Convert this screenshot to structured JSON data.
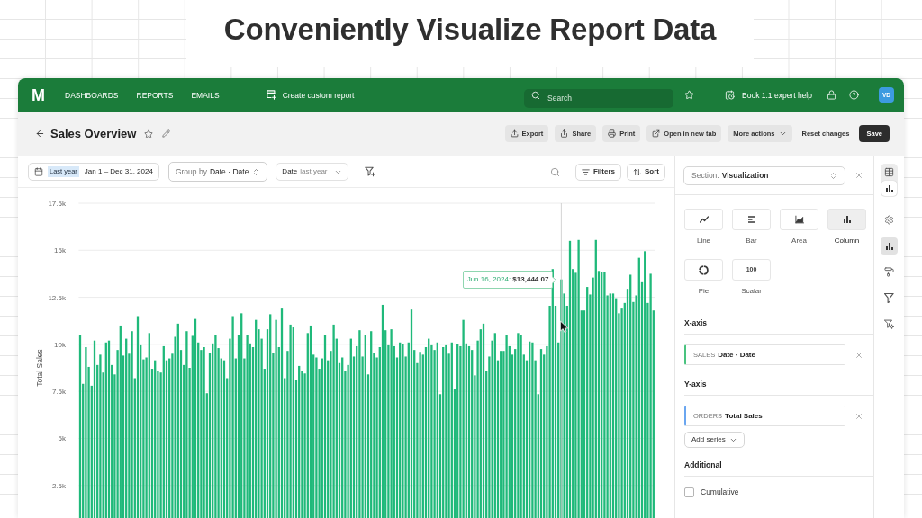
{
  "headline": "Conveniently Visualize Report Data",
  "nav": {
    "logo": "M",
    "links": [
      "DASHBOARDS",
      "REPORTS",
      "EMAILS"
    ],
    "create_report": "Create custom report",
    "search": {
      "placeholder": "Search"
    },
    "help_link": "Book 1:1 expert help",
    "avatar": "VD"
  },
  "report": {
    "title": "Sales Overview",
    "actions": [
      {
        "label": "Export",
        "kind": "upload"
      },
      {
        "label": "Share",
        "kind": "share"
      },
      {
        "label": "Print",
        "kind": "print"
      },
      {
        "label": "Open in new tab",
        "kind": "external"
      },
      {
        "label": "More actions",
        "kind": "menu"
      }
    ],
    "reset": "Reset changes",
    "save": "Save"
  },
  "toolbar": {
    "date_range": {
      "preset": "Last year",
      "range": "Jan 1 – Dec 31, 2024"
    },
    "group_by": {
      "label": "Group by",
      "value": "Date · Date"
    },
    "date_filter": {
      "field": "Date",
      "value": "last year"
    },
    "filters": "Filters",
    "sort": "Sort"
  },
  "chart": {
    "chart_data": {
      "type": "bar",
      "ylabel": "Total Sales",
      "ylim": [
        0,
        17500
      ],
      "grid": true,
      "yticks": [
        {
          "value": 2500,
          "label": "2.5k"
        },
        {
          "value": 5000,
          "label": "5k"
        },
        {
          "value": 7500,
          "label": "7.5k"
        },
        {
          "value": 10000,
          "label": "10k"
        },
        {
          "value": 12500,
          "label": "12.5k"
        },
        {
          "value": 15000,
          "label": "15k"
        },
        {
          "value": 17500,
          "label": "17.5k"
        }
      ],
      "series": [
        {
          "color": "#1fb97a",
          "values": [
            10500,
            7900,
            9850,
            8800,
            7800,
            10200,
            8900,
            9450,
            8500,
            10100,
            10200,
            8900,
            8400,
            9700,
            11000,
            9400,
            10300,
            9500,
            10700,
            8200,
            11500,
            9950,
            9200,
            9300,
            10600,
            8700,
            9150,
            8600,
            8500,
            9900,
            9150,
            9250,
            9500,
            10400,
            11100,
            9700,
            8900,
            10700,
            8750,
            10450,
            11350,
            10100,
            9700,
            9850,
            7400,
            9550,
            10050,
            10500,
            9800,
            9250,
            9150,
            8200,
            10300,
            11500,
            9250,
            10500,
            11650,
            9250,
            10500,
            10050,
            9850,
            11300,
            10800,
            10300,
            8700,
            10800,
            11600,
            9550,
            11300,
            9850,
            11900,
            8200,
            9650,
            11050,
            10900,
            8100,
            8850,
            8600,
            8450,
            10600,
            11000,
            9450,
            9300,
            8700,
            9250,
            10500,
            9150,
            9650,
            11050,
            10300,
            9000,
            9300,
            8600,
            8900,
            10300,
            9350,
            9900,
            10750,
            9350,
            10500,
            8400,
            10700,
            9550,
            9300,
            9850,
            12100,
            10750,
            9950,
            10800,
            9900,
            9300,
            10100,
            10000,
            9350,
            10100,
            11850,
            9700,
            9000,
            9600,
            9450,
            9850,
            10300,
            9950,
            9700,
            10100,
            7350,
            9850,
            9950,
            9500,
            10100,
            7600,
            10000,
            9900,
            11300,
            10050,
            9900,
            9700,
            8350,
            10200,
            10800,
            11100,
            8600,
            9350,
            10200,
            10600,
            9150,
            9650,
            9650,
            10500,
            9900,
            9450,
            9750,
            10600,
            10500,
            9450,
            9150,
            10150,
            10100,
            9150,
            7350,
            9750,
            9450,
            9900,
            12050,
            14000,
            12050,
            10100,
            13450,
            12700,
            12050,
            15500,
            14000,
            13800,
            15550,
            11800,
            11800,
            13050,
            12650,
            13550,
            15550,
            13900,
            13850,
            13850,
            12600,
            12700,
            12700,
            12450,
            11650,
            11900,
            12200,
            12950,
            13700,
            12250,
            12600,
            14600,
            13300,
            14950,
            12200,
            13750,
            11800
          ]
        }
      ],
      "annotations": [
        "Jun 16, 2024: **$13,444.07**"
      ]
    }
  },
  "panel": {
    "section": {
      "label": "Section:",
      "value": "Visualization"
    },
    "chart_types": [
      {
        "label": "Line",
        "kind": "line",
        "selected": false
      },
      {
        "label": "Bar",
        "kind": "bar",
        "selected": false
      },
      {
        "label": "Area",
        "kind": "area",
        "selected": false
      },
      {
        "label": "Column",
        "kind": "column",
        "selected": true
      },
      {
        "label": "Pie",
        "kind": "pie",
        "selected": false
      },
      {
        "label": "Scalar",
        "kind": "scalar",
        "selected": false,
        "icon_text": "100"
      }
    ],
    "x_axis": {
      "title": "X-axis",
      "source": "SALES",
      "field": "Date · Date"
    },
    "y_axis": {
      "title": "Y-axis",
      "source": "ORDERS",
      "field": "Total Sales",
      "add": "Add series"
    },
    "additional": {
      "title": "Additional",
      "options": [
        {
          "label": "Cumulative",
          "checked": false
        }
      ]
    }
  },
  "rail": {
    "views": [
      {
        "kind": "table",
        "selected": false
      },
      {
        "kind": "chart",
        "selected": true
      }
    ],
    "tools": [
      {
        "kind": "settings",
        "selected": false
      },
      {
        "kind": "chart",
        "selected": true
      },
      {
        "kind": "format",
        "selected": false
      },
      {
        "kind": "filter",
        "selected": false
      },
      {
        "kind": "conditions",
        "selected": false
      }
    ]
  }
}
